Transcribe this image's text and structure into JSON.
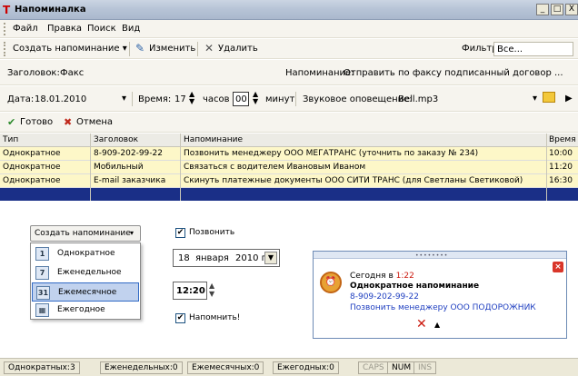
{
  "window": {
    "title": "Напоминалка",
    "minimize": "_",
    "maximize": "□",
    "close": "X"
  },
  "menu": [
    "Файл",
    "Правка",
    "Поиск",
    "Вид"
  ],
  "toolbar": {
    "create": "Создать напоминание",
    "edit": "Изменить",
    "delete": "Удалить",
    "filter_label": "Фильтр",
    "filter_value": "Все..."
  },
  "form": {
    "title_label": "Заголовок:",
    "title_value": "Факс",
    "reminder_label": "Напоминание:",
    "reminder_value": "Отправить по факсу подписанный договор ...",
    "date_label": "Дата:",
    "date_value": "18.01.2010",
    "time_label": "Время:",
    "hours_value": "17",
    "hours_unit": "часов",
    "minutes_value": "00",
    "minutes_unit": "минут",
    "sound_label": "Звуковое оповещение:",
    "sound_value": "Bell.mp3"
  },
  "actions": {
    "ok": "Готово",
    "cancel": "Отмена"
  },
  "table": {
    "headers": [
      "Тип",
      "Заголовок",
      "Напоминание",
      "Время"
    ],
    "rows": [
      [
        "Однократное",
        "8-909-202-99-22",
        "Позвонить менеджеру ООО МЕГАТРАНС (уточнить по заказу № 234)",
        "10:00"
      ],
      [
        "Однократное",
        "Мобильный",
        "Связаться с водителем Ивановым Иваном",
        "11:20"
      ],
      [
        "Однократное",
        "E-mail заказчика",
        "Скинуть платежные документы ООО СИТИ ТРАНС (для Светланы Светиковой)",
        "16:30"
      ]
    ]
  },
  "demo": {
    "create_button": "Создать напоминание",
    "menu_items": [
      {
        "icon": "calendar-once-icon",
        "glyph": "1",
        "label": "Однократное"
      },
      {
        "icon": "calendar-week-icon",
        "glyph": "7",
        "label": "Еженедельное"
      },
      {
        "icon": "calendar-month-icon",
        "glyph": "31",
        "label": "Ежемесячное"
      },
      {
        "icon": "calendar-year-icon",
        "glyph": "▦",
        "label": "Ежегодное"
      }
    ],
    "call_label": "Позвонить",
    "date_day": "18",
    "date_month": "января",
    "date_year": "2010 г.",
    "time": "12:20",
    "remind_label": "Напомнить!"
  },
  "notification": {
    "today": "Сегодня в",
    "time": "1:22",
    "kind": "Однократное напоминание",
    "phone": "8-909-202-99-22",
    "text": "Позвонить менеджеру ООО ПОДОРОЖНИК"
  },
  "status": [
    "Однократных:3",
    "Еженедельных:0",
    "Ежемесячных:0",
    "Ежегодных:0"
  ],
  "indicators": [
    "CAPS",
    "NUM",
    "INS"
  ],
  "colors": {
    "selected_row": "#fdf7c8",
    "highlight_row": "#1a2f87",
    "link": "#1f3fc0",
    "accent": "#cc1a0f"
  }
}
